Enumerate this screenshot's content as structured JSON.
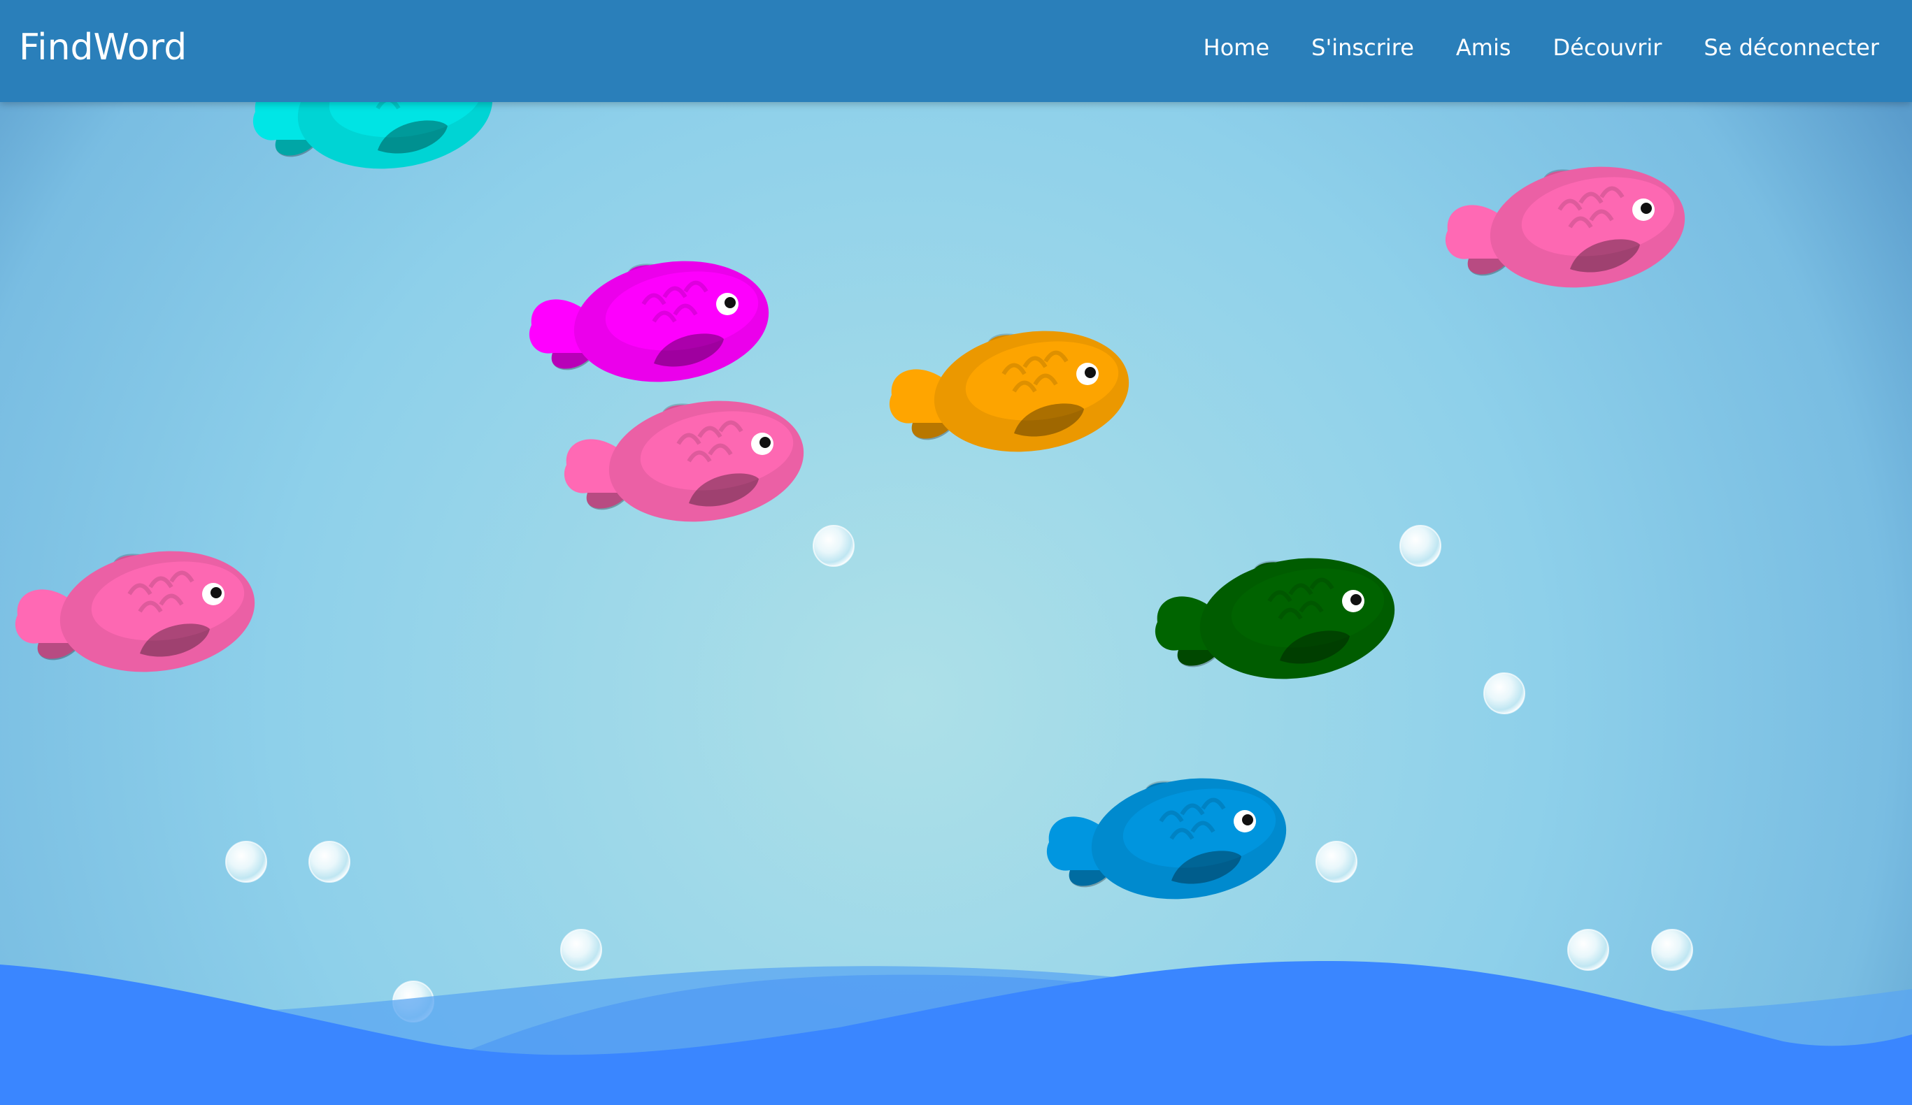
{
  "app": {
    "title": "FindWord"
  },
  "nav": {
    "items": [
      {
        "id": "home",
        "label": "Home"
      },
      {
        "id": "signup",
        "label": "S'inscrire"
      },
      {
        "id": "friends",
        "label": "Amis"
      },
      {
        "id": "discover",
        "label": "Découvrir"
      },
      {
        "id": "logout",
        "label": "Se déconnecter"
      }
    ]
  },
  "colors": {
    "navbar": "#2a7fba",
    "nav_text": "#ffffff",
    "water_center": "#a7dde7",
    "water_edge": "#5ba3d0",
    "wave_front": "#3a86ff",
    "wave_back": "#5aa5f2"
  },
  "scene": {
    "fish": [
      {
        "name": "fish-cyan",
        "color": "#00e6e6"
      },
      {
        "name": "fish-magenta",
        "color": "#ff00ff"
      },
      {
        "name": "fish-pink-1",
        "color": "#ff69b4"
      },
      {
        "name": "fish-orange",
        "color": "#ffa500"
      },
      {
        "name": "fish-pink-2",
        "color": "#ff69b4"
      },
      {
        "name": "fish-pink-3",
        "color": "#ff69b4"
      },
      {
        "name": "fish-green",
        "color": "#006400"
      },
      {
        "name": "fish-blue",
        "color": "#0096e0"
      }
    ],
    "bubbles_icon": "bubble-icon"
  }
}
